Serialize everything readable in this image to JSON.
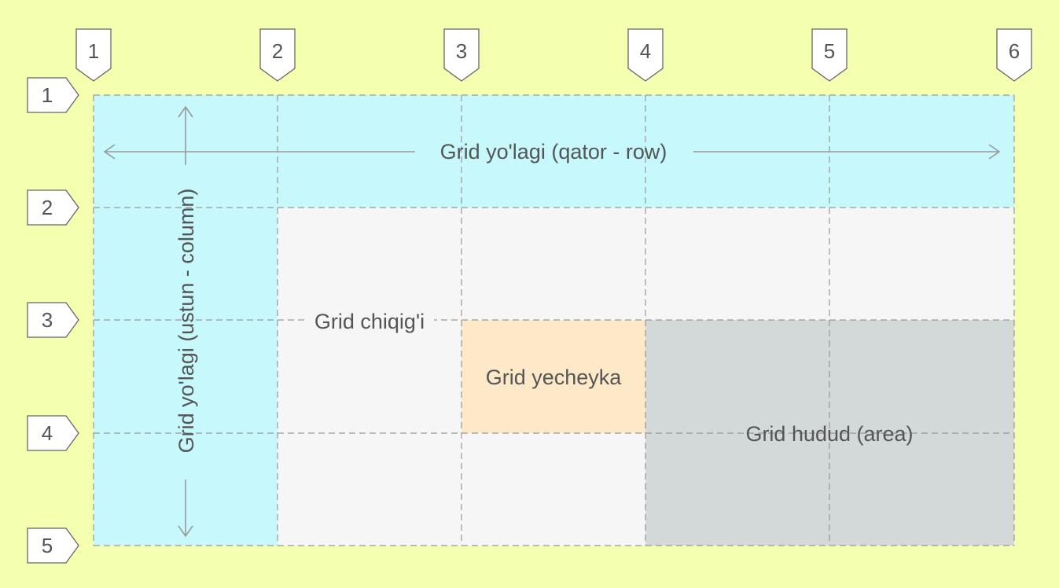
{
  "colors": {
    "background": "#f5ffb0",
    "track": "#c6f8fc",
    "cell_default": "#f6f6f6",
    "cell_highlight": "#fde8c8",
    "area": "#d3d8d8",
    "lines": "#999999",
    "text": "#555555",
    "marker_fill": "#ffffff",
    "marker_stroke": "#666666"
  },
  "grid": {
    "columns": 5,
    "rows": 4,
    "column_line_labels": [
      "1",
      "2",
      "3",
      "4",
      "5",
      "6"
    ],
    "row_line_labels": [
      "1",
      "2",
      "3",
      "4",
      "5"
    ]
  },
  "labels": {
    "row_track": "Grid yo'lagi (qator - row)",
    "column_track": "Grid yo'lagi (ustun - column)",
    "grid_line": "Grid chiqig'i",
    "grid_cell": "Grid yecheyka",
    "grid_area": "Grid hudud (area)"
  }
}
